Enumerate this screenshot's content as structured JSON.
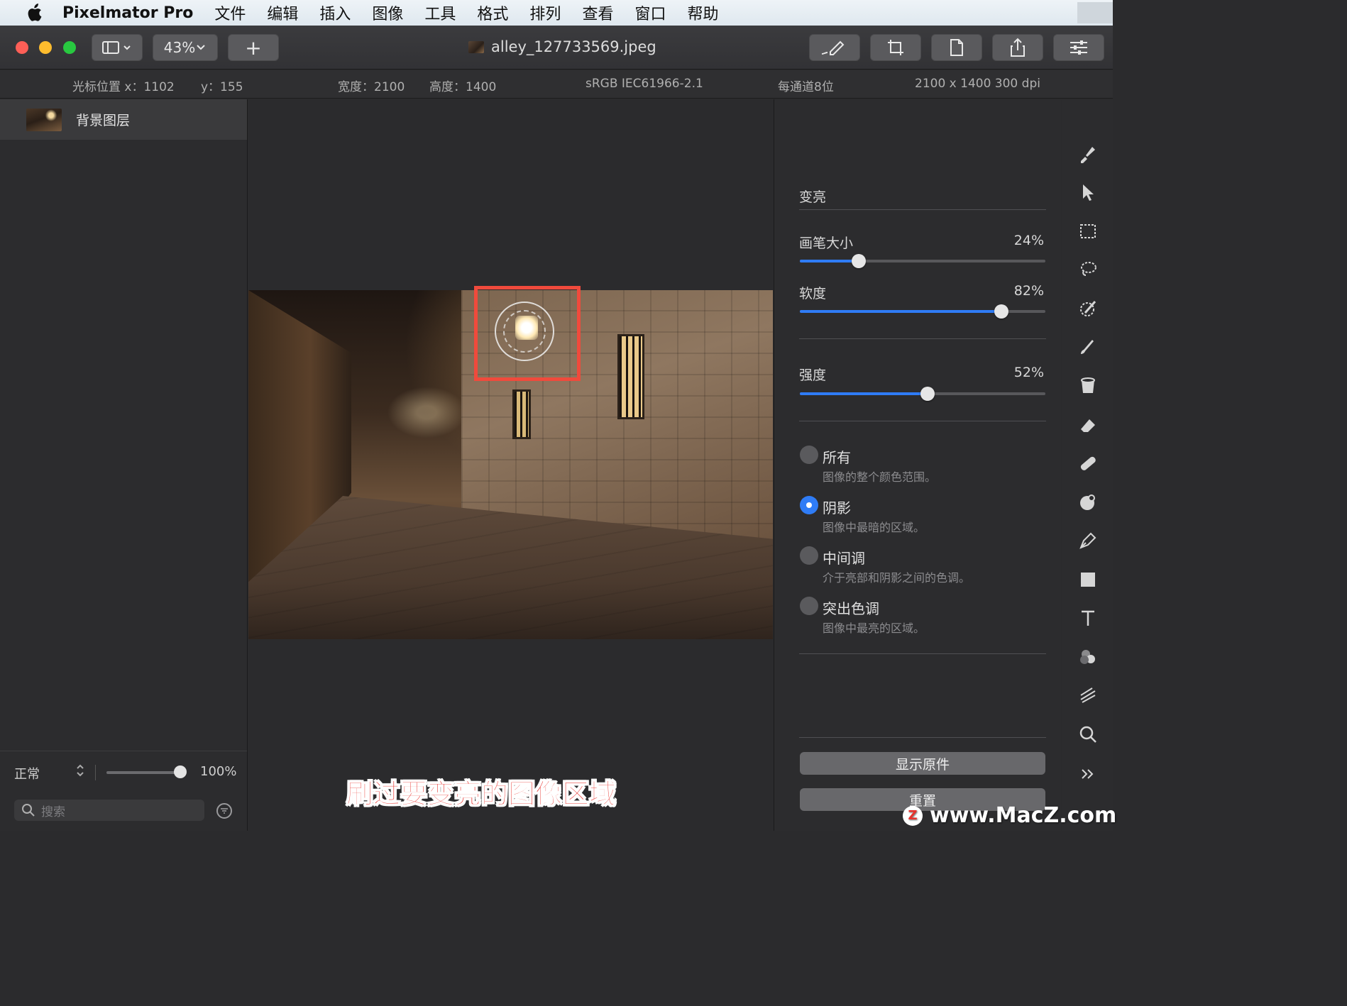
{
  "menubar": {
    "app_name": "Pixelmator Pro",
    "items": [
      "文件",
      "编辑",
      "插入",
      "图像",
      "工具",
      "格式",
      "排列",
      "查看",
      "窗口",
      "帮助"
    ]
  },
  "toolbar": {
    "zoom": "43%",
    "add_label": "+",
    "document_title": "alley_127733569.jpeg"
  },
  "infobar": {
    "cursor_x": "光标位置 x：1102",
    "cursor_y": "y：155",
    "width": "宽度：2100",
    "height": "高度：1400",
    "color_profile": "sRGB IEC61966-2.1",
    "bit_depth": "每通道8位",
    "dimensions": "2100 x 1400 300 dpi"
  },
  "layers": {
    "items": [
      {
        "name": "背景图层"
      }
    ],
    "blend_mode": "正常",
    "opacity": "100%",
    "opacity_fraction": 1.0,
    "search_placeholder": "搜索"
  },
  "canvas": {
    "caption": "刷过要变亮的图像区域"
  },
  "panel": {
    "title": "变亮",
    "brush_size": {
      "label": "画笔大小",
      "value": "24%",
      "fraction": 0.24
    },
    "softness": {
      "label": "软度",
      "value": "82%",
      "fraction": 0.82
    },
    "strength": {
      "label": "强度",
      "value": "52%",
      "fraction": 0.52
    },
    "ranges": [
      {
        "label": "所有",
        "desc": "图像的整个颜色范围。",
        "checked": false
      },
      {
        "label": "阴影",
        "desc": "图像中最暗的区域。",
        "checked": true
      },
      {
        "label": "中间调",
        "desc": "介于亮部和阴影之间的色调。",
        "checked": false
      },
      {
        "label": "突出色调",
        "desc": "图像中最亮的区域。",
        "checked": false
      }
    ],
    "show_original": "显示原件",
    "reset": "重置"
  },
  "tools": [
    "paint-brush-icon",
    "arrow-icon",
    "rect-select-icon",
    "lasso-icon",
    "magic-wand-icon",
    "brush-icon",
    "bucket-icon",
    "eraser-icon",
    "bandage-icon",
    "effects-icon",
    "pen-icon",
    "shape-icon",
    "text-icon",
    "color-adjust-icon",
    "distort-icon",
    "zoom-icon",
    "more-icon"
  ],
  "watermark": "www.MacZ.com",
  "colors": {
    "accent": "#2f7cf6",
    "highlight_box": "#f04a3c",
    "caption": "#e8322d"
  }
}
